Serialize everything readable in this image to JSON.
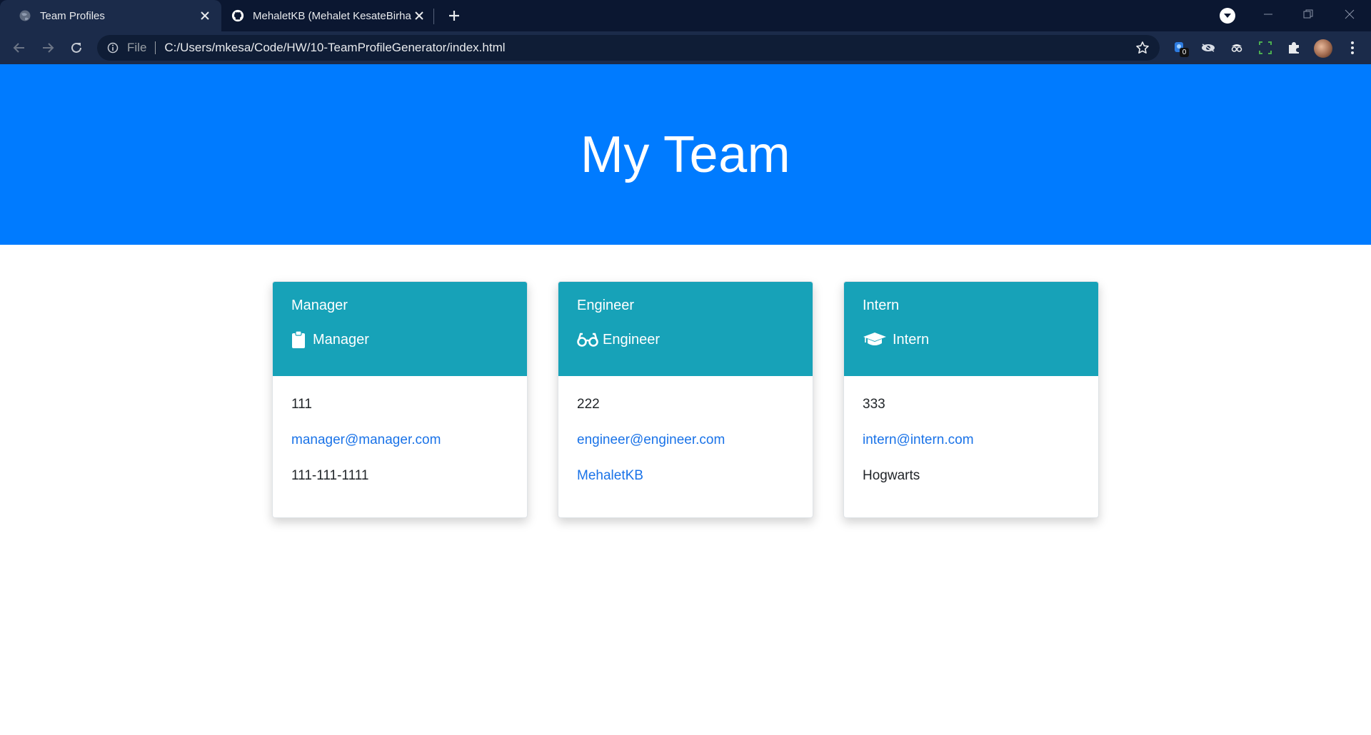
{
  "browser": {
    "tabs": [
      {
        "title": "Team Profiles",
        "icon": "globe-icon",
        "active": true
      },
      {
        "title": "MehaletKB (Mehalet KesateBirhan)",
        "icon": "github-icon",
        "active": false
      }
    ],
    "address": {
      "scheme": "File",
      "url": "C:/Users/mkesa/Code/HW/10-TeamProfileGenerator/index.html"
    },
    "extension_badge": "0"
  },
  "page": {
    "heading": "My Team",
    "cards": [
      {
        "name": "Manager",
        "role": "Manager",
        "role_icon": "clipboard-icon",
        "id": "111",
        "email": "manager@manager.com",
        "extra": "111-111-1111",
        "extra_is_link": false
      },
      {
        "name": "Engineer",
        "role": "Engineer",
        "role_icon": "glasses-icon",
        "id": "222",
        "email": "engineer@engineer.com",
        "extra": "MehaletKB",
        "extra_is_link": true
      },
      {
        "name": "Intern",
        "role": "Intern",
        "role_icon": "graduation-cap-icon",
        "id": "333",
        "email": "intern@intern.com",
        "extra": "Hogwarts",
        "extra_is_link": false
      }
    ]
  },
  "colors": {
    "tabbar": "#0b1731",
    "toolbar": "#1b2b4a",
    "jumbotron": "#007bff",
    "card_header": "#17a2b8",
    "link": "#1a73e8"
  }
}
